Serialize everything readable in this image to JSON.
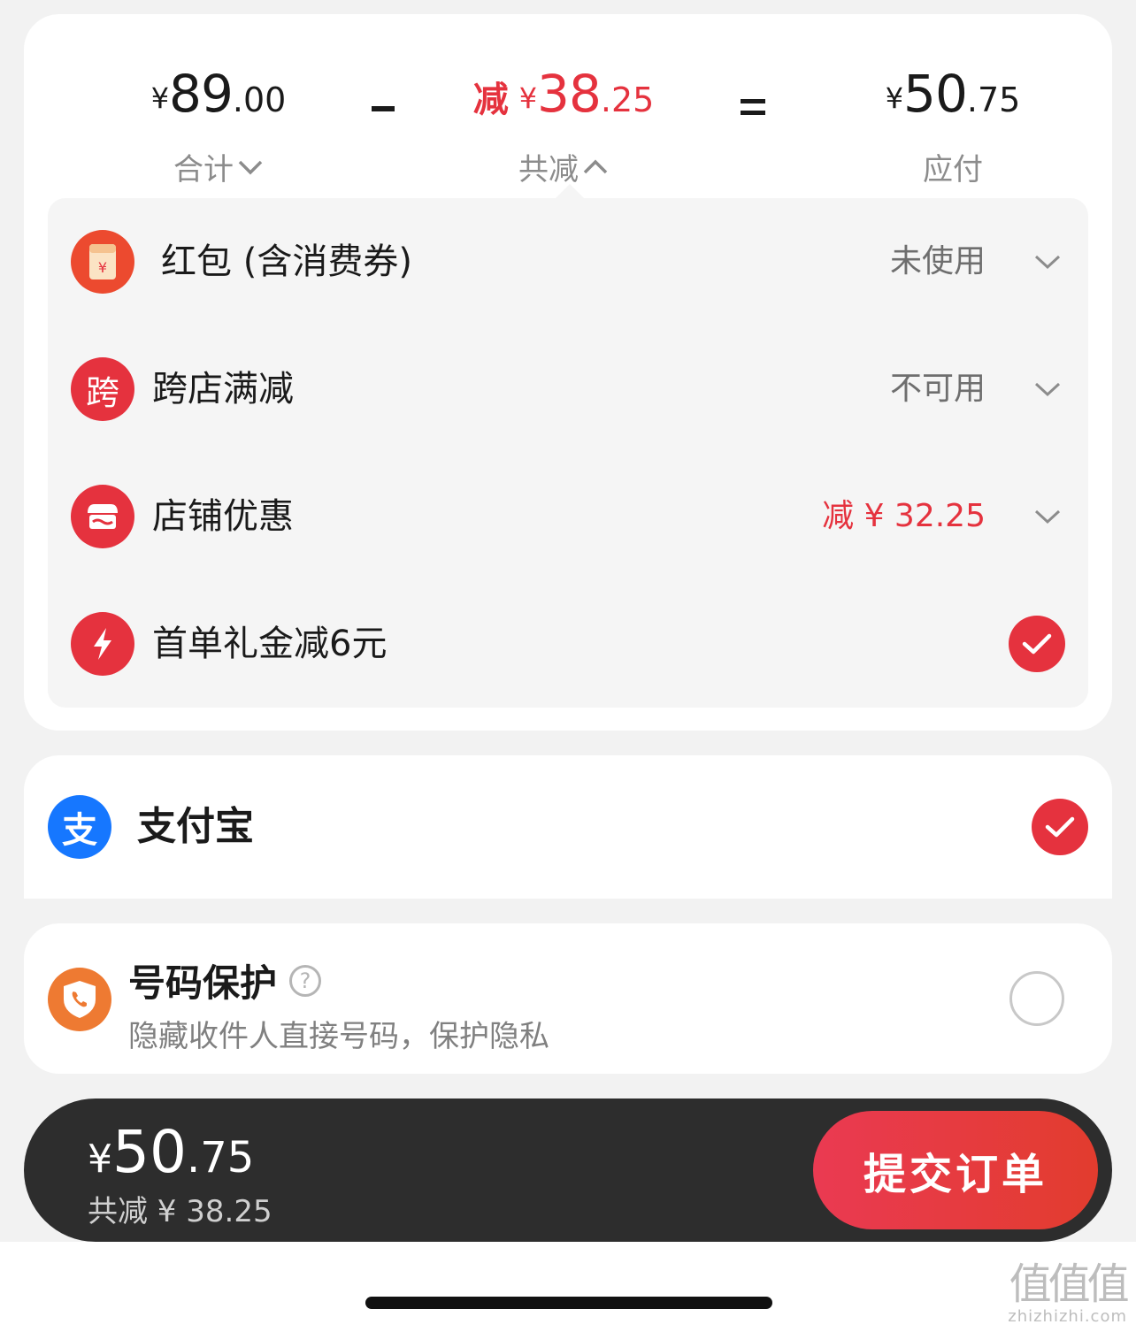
{
  "summary": {
    "total": {
      "yen": "¥",
      "int": "89",
      "dec": ".00",
      "label": "合计"
    },
    "discount": {
      "prefix": "减",
      "yen": "¥",
      "int": "38",
      "dec": ".25",
      "label": "共减"
    },
    "payable": {
      "yen": "¥",
      "int": "50",
      "dec": ".75",
      "label": "应付"
    }
  },
  "discounts": [
    {
      "label": "红包 (含消费券)",
      "status": "未使用",
      "icon": "red-envelope-icon",
      "glyph": "¥"
    },
    {
      "label": "跨店满减",
      "status": "不可用",
      "icon": "cross-store-icon",
      "glyph": "跨"
    },
    {
      "label": "店铺优惠",
      "status": "减 ¥ 32.25",
      "icon": "shop-icon"
    },
    {
      "label": "首单礼金减6元",
      "icon": "lightning-icon",
      "checked": true
    }
  ],
  "payment": {
    "label": "支付宝",
    "icon": "alipay-icon",
    "glyph": "支",
    "checked": true
  },
  "protection": {
    "title": "号码保护",
    "help": "?",
    "subtitle": "隐藏收件人直接号码，保护隐私",
    "checked": false
  },
  "bottom_bar": {
    "yen": "¥",
    "int": "50",
    "dec": ".75",
    "sub": "共减 ¥ 38.25",
    "submit_label": "提交订单"
  },
  "watermark": {
    "logo": "值值值",
    "url": "zhizhizhi.com"
  },
  "colors": {
    "accent": "#e5323e",
    "alipay": "#1677ff",
    "protect": "#ee7a32",
    "bar": "#2d2d2d"
  }
}
